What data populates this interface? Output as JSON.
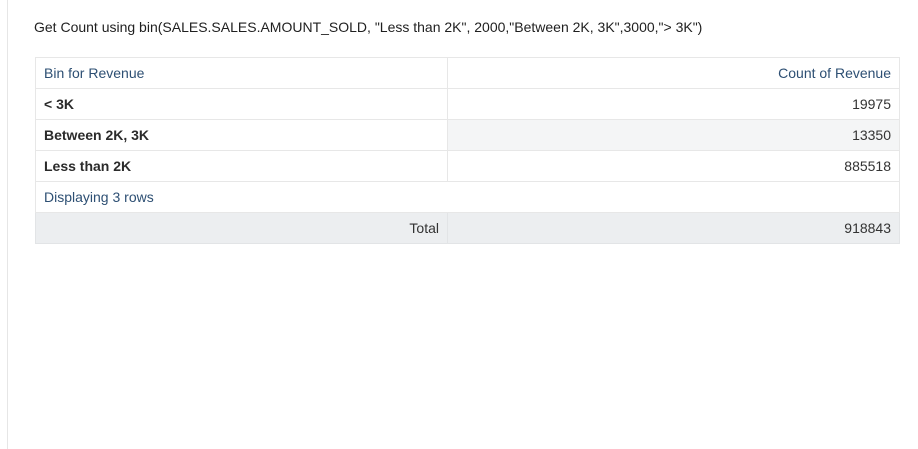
{
  "title": "Get Count using bin(SALES.SALES.AMOUNT_SOLD, \"Less than 2K\", 2000,\"Between 2K, 3K\",3000,\"> 3K\")",
  "table": {
    "header": {
      "col1": "Bin for Revenue",
      "col2": "Count of Revenue"
    },
    "rows": [
      {
        "bin": "< 3K",
        "count": "19975"
      },
      {
        "bin": "Between 2K, 3K",
        "count": "13350"
      },
      {
        "bin": "Less than 2K",
        "count": "885518"
      }
    ],
    "footer": "Displaying 3 rows",
    "total_label": "Total",
    "total_value": "918843"
  }
}
